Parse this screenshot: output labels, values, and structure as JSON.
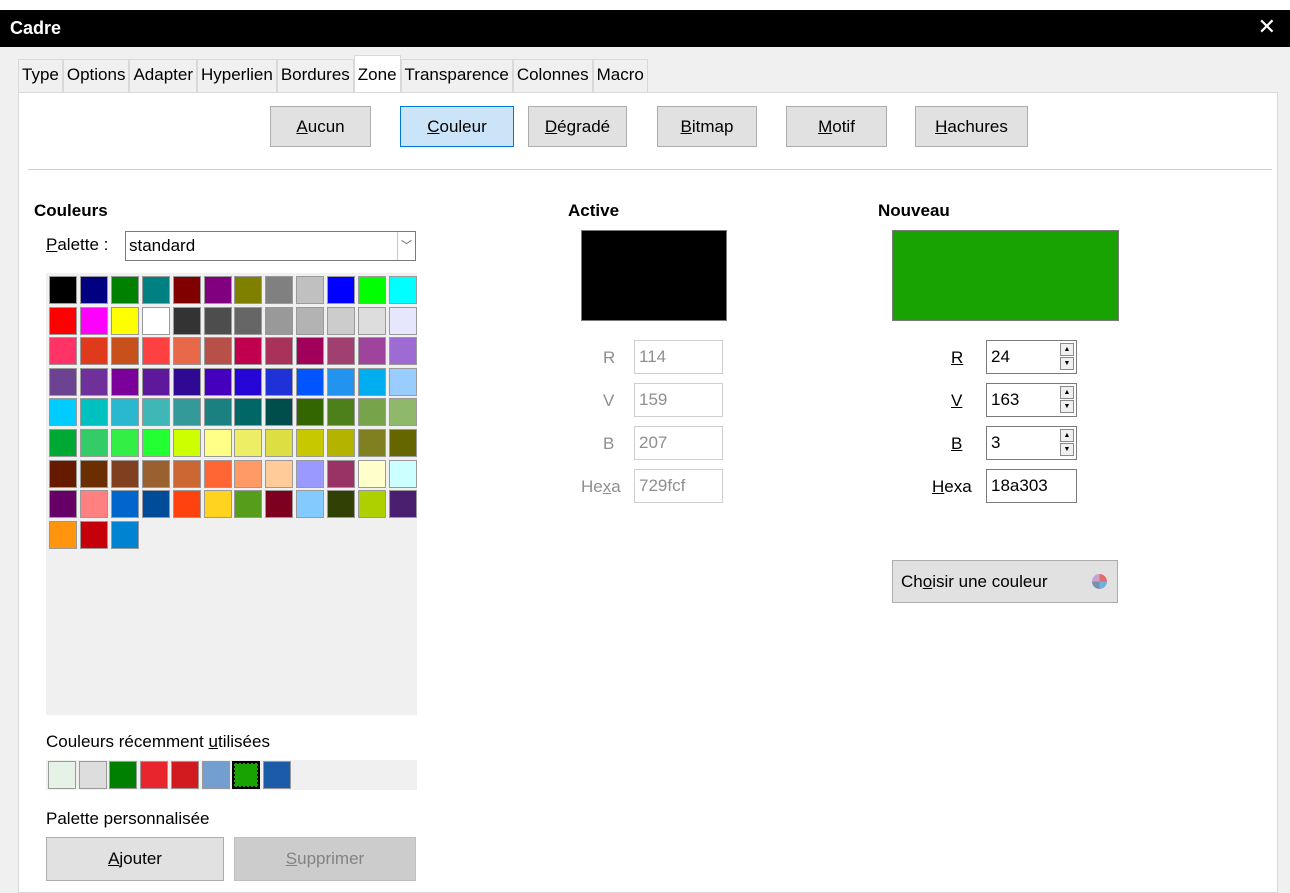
{
  "window": {
    "title": "Cadre"
  },
  "tabs": [
    {
      "label": "Type",
      "active": false
    },
    {
      "label": "Options",
      "active": false
    },
    {
      "label": "Adapter",
      "active": false
    },
    {
      "label": "Hyperlien",
      "active": false
    },
    {
      "label": "Bordures",
      "active": false
    },
    {
      "label": "Zone",
      "active": true
    },
    {
      "label": "Transparence",
      "active": false
    },
    {
      "label": "Colonnes",
      "active": false
    },
    {
      "label": "Macro",
      "active": false
    }
  ],
  "fill_buttons": {
    "aucun": {
      "key": "A",
      "rest": "ucun"
    },
    "couleur": {
      "key": "C",
      "rest": "ouleur"
    },
    "degrade": {
      "key": "D",
      "rest": "égradé"
    },
    "bitmap": {
      "key": "B",
      "rest": "itmap"
    },
    "motif": {
      "key": "M",
      "rest": "otif"
    },
    "hachures": {
      "key": "H",
      "rest": "achures"
    }
  },
  "colors_section": {
    "heading": "Couleurs",
    "palette_label_key": "P",
    "palette_label_rest": "alette :",
    "palette_value": "standard",
    "swatches": [
      "#000000",
      "#000080",
      "#008000",
      "#008080",
      "#800000",
      "#800080",
      "#808000",
      "#808080",
      "#c0c0c0",
      "#0000ff",
      "#00ff00",
      "#00ffff",
      "#ff0000",
      "#ff00ff",
      "#ffff00",
      "#ffffff",
      "#333333",
      "#4d4d4d",
      "#666666",
      "#999999",
      "#b3b3b3",
      "#cccccc",
      "#dddddd",
      "#e6e6ff",
      "#ff3366",
      "#e03a1c",
      "#c8511b",
      "#ff4040",
      "#e8694a",
      "#b8504a",
      "#c0004e",
      "#a8325a",
      "#a0005a",
      "#a04070",
      "#9f449c",
      "#9e6bd3",
      "#6b4391",
      "#70309a",
      "#7b009a",
      "#5e189c",
      "#2f0993",
      "#4500bd",
      "#2606d6",
      "#1e32d8",
      "#0055ff",
      "#2294f0",
      "#00aeef",
      "#99ccff",
      "#00ccff",
      "#00c0c0",
      "#2ab7d0",
      "#40b7b7",
      "#339999",
      "#1a8080",
      "#006666",
      "#004d4d",
      "#336600",
      "#4d801a",
      "#77a34a",
      "#8fb86a",
      "#00a933",
      "#33cc66",
      "#33ee44",
      "#22ff33",
      "#ccff00",
      "#ffff88",
      "#eeee66",
      "#dddd44",
      "#c8c800",
      "#b3b300",
      "#808020",
      "#666600",
      "#661a00",
      "#6b2e00",
      "#804020",
      "#9a6030",
      "#cc6633",
      "#ff6633",
      "#ff9966",
      "#ffcc99",
      "#9999ff",
      "#993366",
      "#ffffcc",
      "#ccffff",
      "#660066",
      "#ff8080",
      "#0066cc",
      "#004c99",
      "#ff420e",
      "#ffd320",
      "#579d1c",
      "#7e0021",
      "#83caff",
      "#314004",
      "#aecf00",
      "#4b1f6f",
      "#ff950e",
      "#c5000b",
      "#0084d1"
    ],
    "recent_label_pre": "Couleurs récemment ",
    "recent_label_key": "u",
    "recent_label_post": "tilisées",
    "recent": [
      "#e6f2e6",
      "#dddddd",
      "#008000",
      "#e8242c",
      "#d11b1f",
      "#729fcf",
      "#18a303",
      "#1c5ba8"
    ],
    "custom_label": "Palette personnalisée",
    "add_key": "A",
    "add_rest": "jouter",
    "delete_key": "S",
    "delete_rest": "upprimer"
  },
  "active": {
    "heading": "Active",
    "color": "#000000",
    "r_label": "R",
    "r": "114",
    "v_label": "V",
    "v": "159",
    "b_label": "B",
    "b": "207",
    "hex_pre": "He",
    "hex_key": "x",
    "hex_post": "a",
    "hex": "729fcf"
  },
  "nouveau": {
    "heading": "Nouveau",
    "color": "#18a303",
    "r_label": "R",
    "r": "24",
    "v_label": "V",
    "v": "163",
    "b_label": "B",
    "b": "3",
    "hex_key": "H",
    "hex_rest": "exa",
    "hex": "18a303",
    "choose_pre": "Ch",
    "choose_key": "o",
    "choose_post": "isir une couleur"
  }
}
